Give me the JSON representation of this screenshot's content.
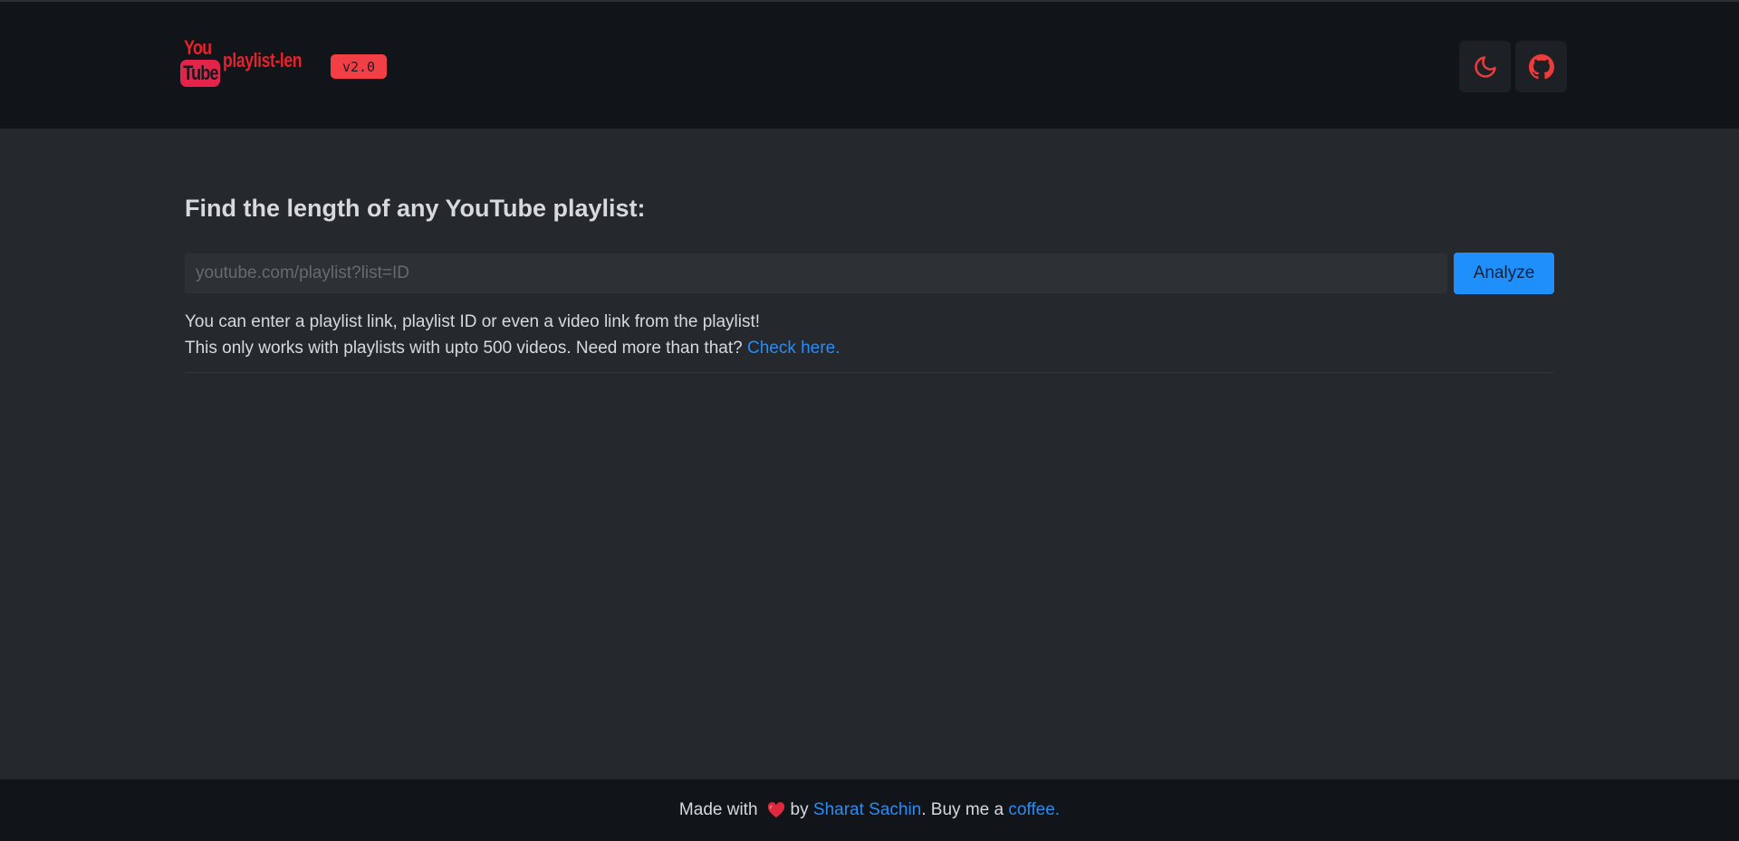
{
  "header": {
    "logo": {
      "you": "You",
      "tube": "Tube",
      "name": "playlist-len"
    },
    "version": "v2.0",
    "buttons": {
      "theme_icon": "moon-icon",
      "github_icon": "github-icon"
    }
  },
  "main": {
    "heading": "Find the length of any YouTube playlist:",
    "search": {
      "placeholder": "youtube.com/playlist?list=ID",
      "value": ""
    },
    "analyze_label": "Analyze",
    "help": {
      "line1": "You can enter a playlist link, playlist ID or even a video link from the playlist!",
      "line2": "This only works with playlists with upto 500 videos. Need more than that? ",
      "line2_link": "Check here."
    }
  },
  "footer": {
    "made_with": "Made with",
    "heart_icon": "heart-icon",
    "by": "by",
    "author": "Sharat Sachin",
    "buy": ". Buy me a ",
    "coffee": "coffee."
  },
  "colors": {
    "background": "#25282d",
    "header_bg": "#111418",
    "accent_red": "#e4232d",
    "badge_red": "#f23f45",
    "primary_blue": "#1e8ffb",
    "link_blue": "#2b8bf2"
  }
}
